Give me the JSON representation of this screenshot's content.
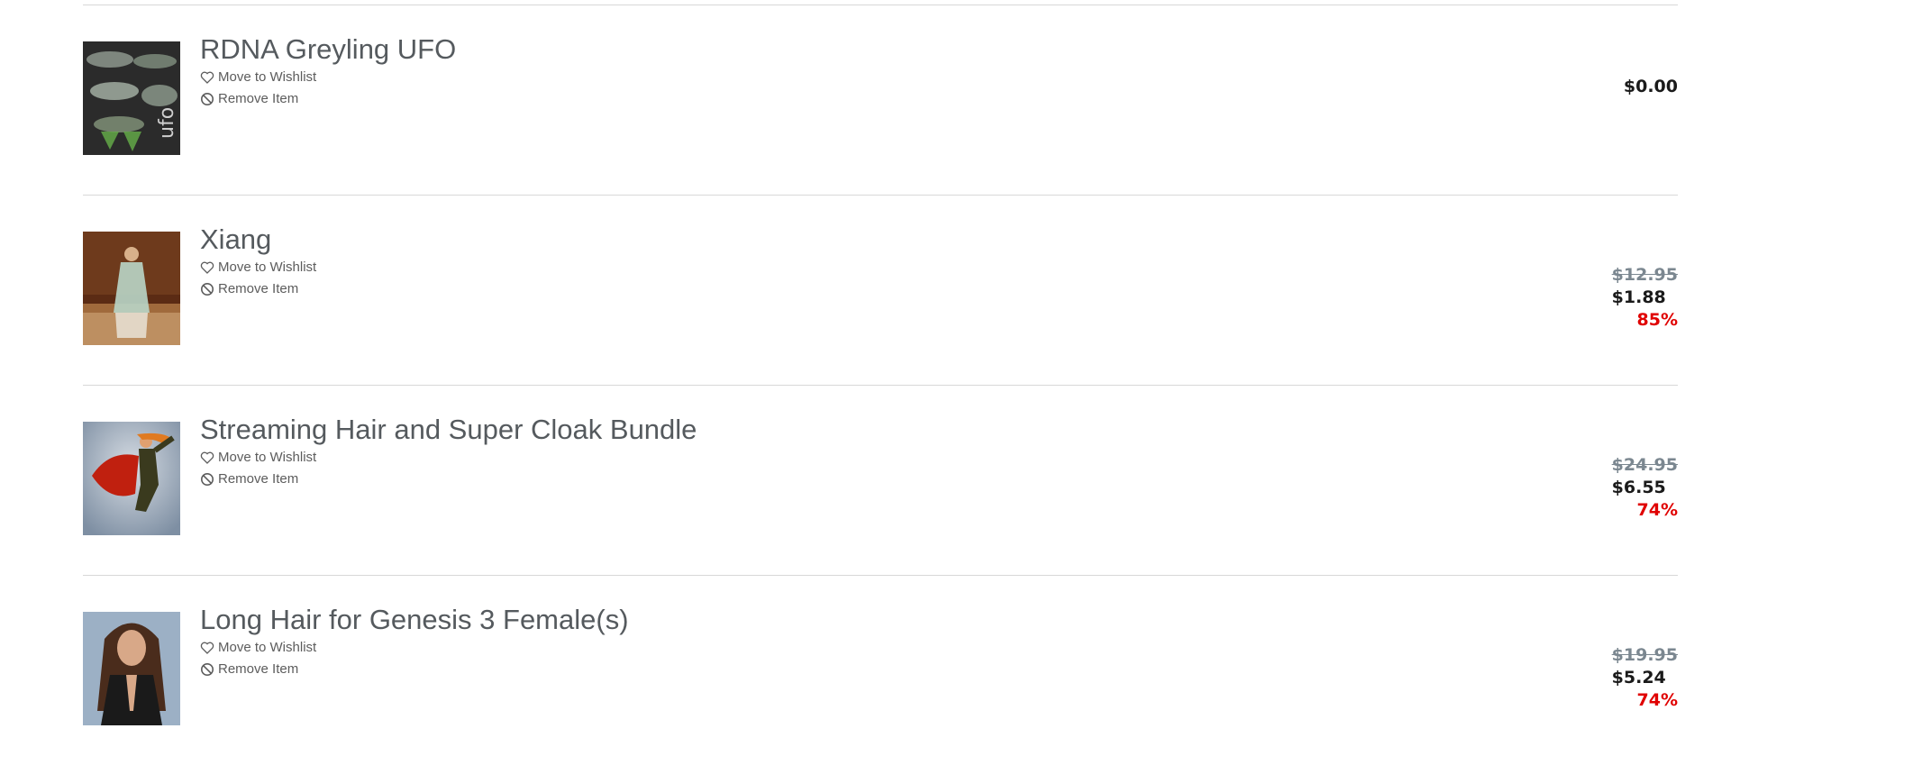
{
  "items": [
    {
      "title": "RDNA Greyling UFO",
      "wishlist_label": "Move to Wishlist",
      "remove_label": "Remove Item",
      "price": "$0.00",
      "old_price": null,
      "discount": null,
      "thumb_colors": [
        "#2b2b2b",
        "#7d8b7b"
      ]
    },
    {
      "title": "Xiang",
      "wishlist_label": "Move to Wishlist",
      "remove_label": "Remove Item",
      "old_price": "$12.95",
      "price": "$1.88",
      "discount": "85%",
      "thumb_colors": [
        "#5b2b14",
        "#c9a070"
      ]
    },
    {
      "title": "Streaming Hair and Super Cloak Bundle",
      "wishlist_label": "Move to Wishlist",
      "remove_label": "Remove Item",
      "old_price": "$24.95",
      "price": "$6.55",
      "discount": "74%",
      "thumb_colors": [
        "#7e8fa3",
        "#c8cfd8"
      ]
    },
    {
      "title": "Long Hair for Genesis 3 Female(s)",
      "wishlist_label": "Move to Wishlist",
      "remove_label": "Remove Item",
      "old_price": "$19.95",
      "price": "$5.24",
      "discount": "74%",
      "thumb_colors": [
        "#6d86a1",
        "#a9bccf"
      ]
    }
  ],
  "colors": {
    "title": "#555a5e",
    "old_price": "#7b8790",
    "price": "#1a1a1a",
    "discount": "#e00000",
    "divider": "#d8d8d8"
  },
  "icons": {
    "wishlist": "heart-outline-icon",
    "remove": "prohibited-circle-icon"
  }
}
